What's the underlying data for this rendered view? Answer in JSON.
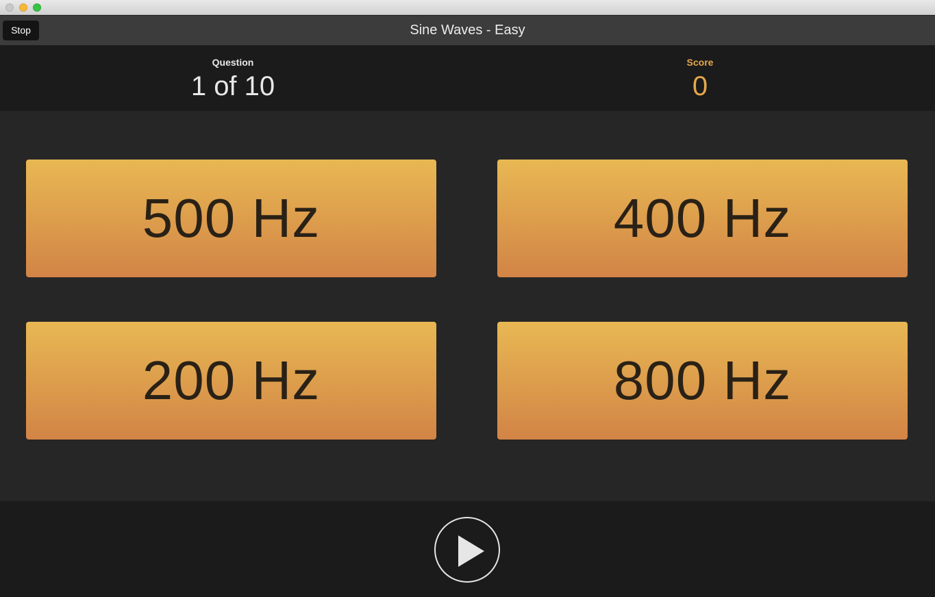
{
  "window": {
    "title": "Sine Waves - Easy"
  },
  "toolbar": {
    "stop_label": "Stop"
  },
  "stats": {
    "question_label": "Question",
    "question_value": "1 of 10",
    "score_label": "Score",
    "score_value": "0"
  },
  "answers": [
    {
      "label": "500 Hz"
    },
    {
      "label": "400 Hz"
    },
    {
      "label": "200 Hz"
    },
    {
      "label": "800 Hz"
    }
  ],
  "footer": {
    "play_icon": "play-icon"
  },
  "colors": {
    "accent": "#e5a84c",
    "answer_gradient_top": "#e8b853",
    "answer_gradient_bottom": "#d28446",
    "background": "#1b1b1b",
    "panel": "#262626"
  }
}
